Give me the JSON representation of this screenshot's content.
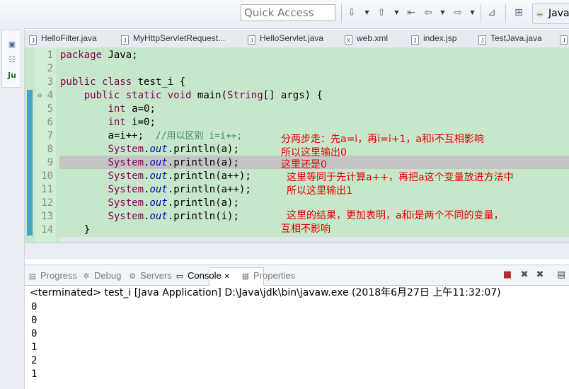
{
  "toolbar": {
    "quick_access_placeholder": "Quick Access",
    "perspective_label": "Java"
  },
  "editor_tabs": [
    {
      "label": "HelloFilter.java",
      "type": "J"
    },
    {
      "label": "MyHttpServletRequest...",
      "type": "J"
    },
    {
      "label": "HelloServlet.java",
      "type": "J"
    },
    {
      "label": "web.xml",
      "type": "X"
    },
    {
      "label": "index.jsp",
      "type": "J"
    },
    {
      "label": "TestJava.java",
      "type": "J"
    }
  ],
  "code": {
    "line_numbers": [
      "1",
      "2",
      "3",
      "4",
      "5",
      "6",
      "7",
      "8",
      "9",
      "10",
      "11",
      "12",
      "13",
      "14"
    ],
    "lines": {
      "l1": {
        "kw": "package",
        "rest": " Java;"
      },
      "l3": {
        "kw1": "public",
        "kw2": "class",
        "rest": " test_i {"
      },
      "l4": {
        "kw1": "public",
        "kw2": "static",
        "kw3": "void",
        "name": " main(",
        "type": "String",
        "rest": "[] args) {"
      },
      "l5": {
        "kw": "int",
        "rest": " a=0;"
      },
      "l6": {
        "kw": "int",
        "rest": " i=0;"
      },
      "l7": {
        "stmt": "a=i++;  ",
        "comment": "//用以区别 i=i++;"
      },
      "l8": {
        "arg": "(a);"
      },
      "l9": {
        "arg": "(a);"
      },
      "l10": {
        "arg": "(a++);"
      },
      "l11": {
        "arg": "(a++);"
      },
      "l12": {
        "arg": "(a);"
      },
      "l13": {
        "arg": "(i);"
      },
      "l14": {
        "rest": "}"
      }
    },
    "sys": "System",
    "out": "out",
    "println": "println"
  },
  "annotations": {
    "a1": "分两步走：先a=i，再i=i+1，a和i不互相影响",
    "a2": "所以这里输出0",
    "a3": "这里还是0",
    "a4": "这里等同于先计算a++，再把a这个变量放进方法中",
    "a5": "所以这里输出1",
    "a6": "这里的结果，更加表明，a和i是两个不同的变量，",
    "a7": "互相不影响"
  },
  "panel": {
    "tabs": [
      {
        "label": "Progress",
        "icon": "progress-icon"
      },
      {
        "label": "Debug",
        "icon": "debug-icon"
      },
      {
        "label": "Servers",
        "icon": "servers-icon"
      },
      {
        "label": "Console",
        "icon": "console-icon"
      },
      {
        "label": "Properties",
        "icon": "properties-icon"
      }
    ],
    "active_tab": "Console",
    "close_glyph": "✕"
  },
  "console": {
    "header": "<terminated> test_i [Java Application] D:\\Java\\jdk\\bin\\javaw.exe (2018年6月27日 上午11:32:07)",
    "output": [
      "0",
      "0",
      "0",
      "1",
      "2",
      "1"
    ]
  }
}
